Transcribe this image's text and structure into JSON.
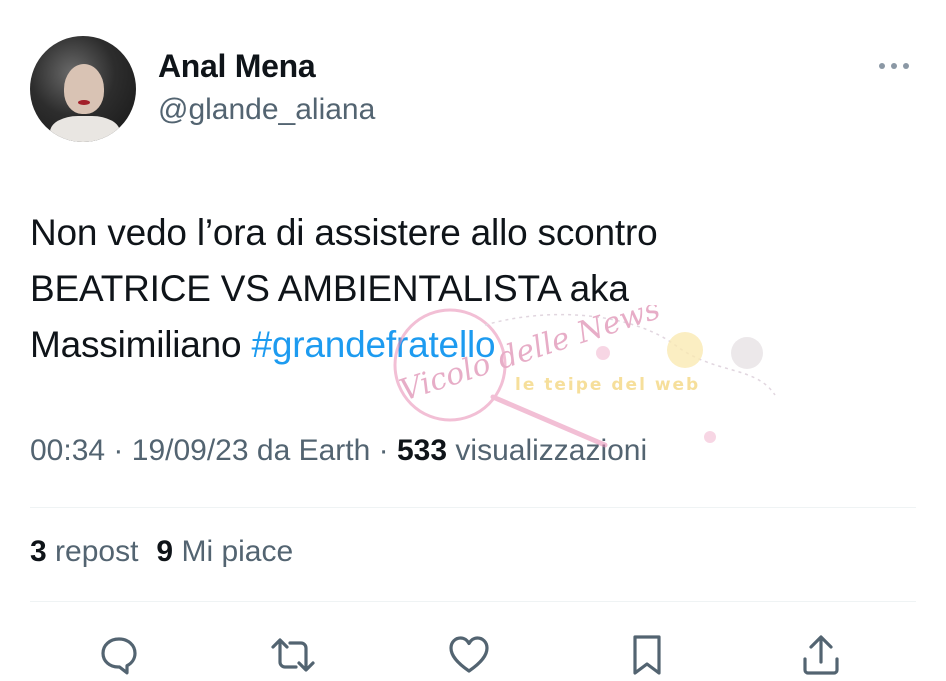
{
  "author": {
    "display_name": "Anal Mena",
    "handle": "@glande_aliana"
  },
  "tweet": {
    "line1": "Non vedo l’ora di assistere allo scontro",
    "line2": "BEATRICE VS AMBIENTALISTA aka",
    "line3_prefix": "Massimiliano ",
    "hashtag": "#grandefratello",
    "hashtag_color": "#1d9bf0"
  },
  "meta": {
    "time": "00:34",
    "separator": "·",
    "date": "19/09/23",
    "source": "da Earth",
    "views_count": "533",
    "views_label": "visualizzazioni"
  },
  "stats": {
    "reposts_count": "3",
    "reposts_label": "repost",
    "likes_count": "9",
    "likes_label": "Mi piace"
  },
  "actions": [
    {
      "name": "reply",
      "icon": "comment-bubble-icon"
    },
    {
      "name": "repost",
      "icon": "repost-arrows-icon"
    },
    {
      "name": "like",
      "icon": "heart-icon"
    },
    {
      "name": "bookmark",
      "icon": "bookmark-icon"
    },
    {
      "name": "share",
      "icon": "share-upload-icon"
    }
  ],
  "watermark": {
    "script_text": "Vicolo delle News",
    "banner_text": "le teipe del web"
  },
  "colors": {
    "text_primary": "#0f1419",
    "text_secondary": "#536471",
    "accent": "#1d9bf0",
    "divider": "#eff3f4",
    "icon": "#536471"
  }
}
